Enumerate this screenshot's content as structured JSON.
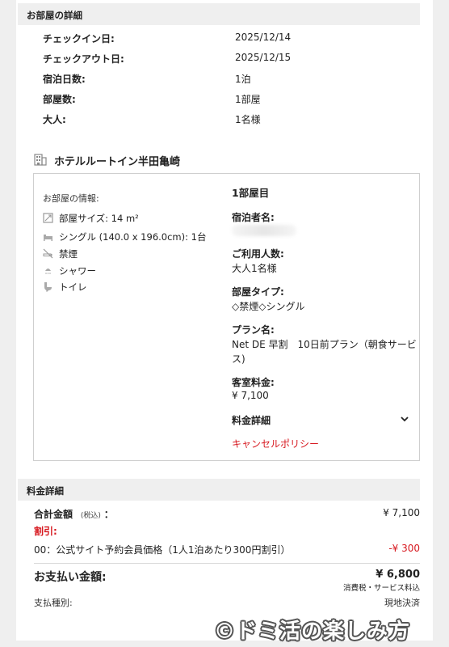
{
  "room_details": {
    "title": "お部屋の詳細",
    "rows": [
      {
        "label": "チェックイン日:",
        "value": "2025/12/14"
      },
      {
        "label": "チェックアウト日:",
        "value": "2025/12/15"
      },
      {
        "label": "宿泊日数:",
        "value": "1泊"
      },
      {
        "label": "部屋数:",
        "value": "1部屋"
      },
      {
        "label": "大人:",
        "value": "1名様"
      }
    ]
  },
  "hotel": {
    "name": "ホテルルートイン半田亀崎",
    "icon": "building-icon"
  },
  "room_info": {
    "title": "お部屋の情報:",
    "features": [
      {
        "icon": "room-size-icon",
        "text": "部屋サイズ: 14 m²"
      },
      {
        "icon": "bed-icon",
        "text": "シングル (140.0 x 196.0cm): 1台"
      },
      {
        "icon": "no-smoking-icon",
        "text": "禁煙"
      },
      {
        "icon": "shower-icon",
        "text": "シャワー"
      },
      {
        "icon": "toilet-icon",
        "text": "トイレ"
      }
    ]
  },
  "room_card": {
    "heading": "1部屋目",
    "guest_label": "宿泊者名:",
    "users_label": "ご利用人数:",
    "users_value": "大人1名様",
    "type_label": "部屋タイプ:",
    "type_value": "◇禁煙◇シングル",
    "plan_label": "プラン名:",
    "plan_line1": "Net DE 早割　10日前プラン（朝食サービ",
    "plan_line2": "ス)",
    "rate_label": "客室料金:",
    "rate_value": "¥ 7,100",
    "fee_detail_label": "料金詳細",
    "cancel_policy_label": "キャンセルポリシー"
  },
  "fee": {
    "title": "料金詳細",
    "total_label": "合計金額",
    "tax_in": "(税込)",
    "colon": "：",
    "total_value": "¥ 7,100",
    "discount_label": "割引:",
    "discount_item": "00：公式サイト予約会員価格（1人1泊あたり300円割引）",
    "discount_value": "-¥ 300",
    "payment_label": "お支払い金額:",
    "payment_value": "¥ 6,800",
    "payment_note": "消費税・サービス料込",
    "method_label": "支払種別:",
    "method_value": "現地決済"
  },
  "watermark": "©ドミ活の楽しみ方",
  "colors": {
    "accent_red": "#d71920",
    "section_bg": "#efefef",
    "border": "#cfcfcf"
  }
}
